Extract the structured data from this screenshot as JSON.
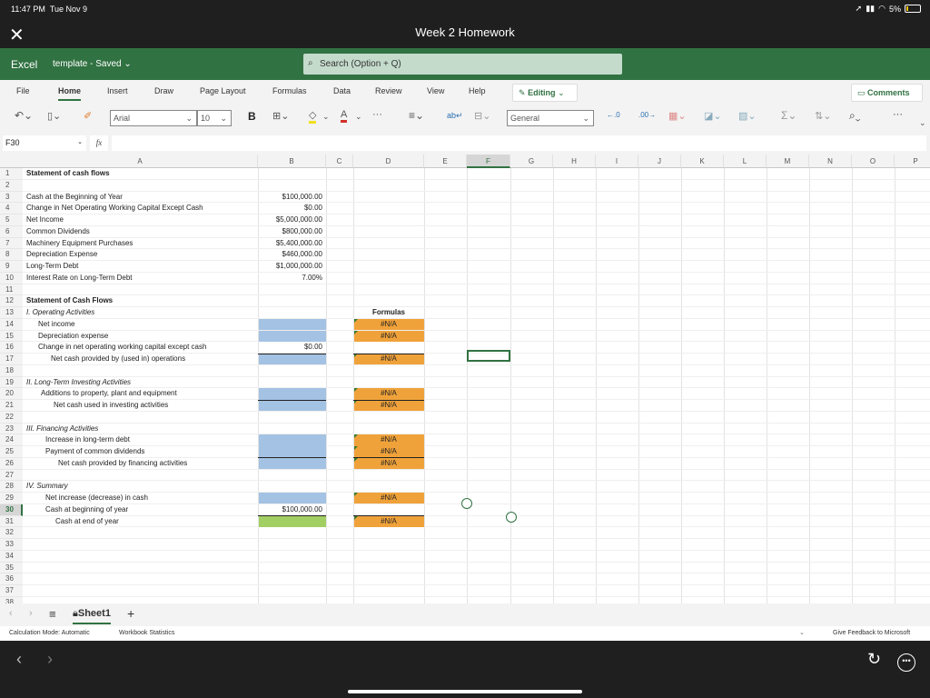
{
  "status_bar": {
    "time": "11:47 PM",
    "date": "Tue Nov 9",
    "battery": "5%"
  },
  "window": {
    "title": "Week 2 Homework",
    "close_icon": "close-icon"
  },
  "app_bar": {
    "app_name": "Excel",
    "doc_name": "template",
    "saved_status": "Saved",
    "search_placeholder": "Search (Option + Q)"
  },
  "ribbon": {
    "tabs": [
      {
        "label": "File"
      },
      {
        "label": "Home",
        "active": true
      },
      {
        "label": "Insert"
      },
      {
        "label": "Draw"
      },
      {
        "label": "Page Layout"
      },
      {
        "label": "Formulas"
      },
      {
        "label": "Data"
      },
      {
        "label": "Review"
      },
      {
        "label": "View"
      },
      {
        "label": "Help"
      }
    ],
    "editing_label": "Editing",
    "comments_label": "Comments",
    "font_name": "Arial",
    "font_size": "10",
    "bold_label": "B",
    "number_format": "General",
    "more_label": "···"
  },
  "formula_bar": {
    "name_box": "F30",
    "fx_label": "fx",
    "formula": ""
  },
  "columns": [
    "A",
    "B",
    "C",
    "D",
    "E",
    "F",
    "G",
    "H",
    "I",
    "J",
    "K",
    "L",
    "M",
    "N",
    "O",
    "P"
  ],
  "selected_column": "F",
  "selected_row": "30",
  "rows": [
    "1",
    "2",
    "3",
    "4",
    "5",
    "6",
    "7",
    "8",
    "9",
    "10",
    "11",
    "12",
    "13",
    "14",
    "15",
    "16",
    "17",
    "18",
    "19",
    "20",
    "21",
    "22",
    "23",
    "24",
    "25",
    "26",
    "27",
    "28",
    "29",
    "30",
    "31",
    "32",
    "33",
    "34",
    "35",
    "36",
    "37",
    "38"
  ],
  "cells": {
    "A1": "Statement of cash flows",
    "A3": "Cash at the Beginning of Year",
    "A4": "Change in Net Operating Working Capital Except Cash",
    "A5": "Net Income",
    "A6": "Common Dividends",
    "A7": "Machinery Equipment Purchases",
    "A8": "Depreciation Expense",
    "A9": "Long-Term Debt",
    "A10": "Interest Rate on Long-Term Debt",
    "B3": "$100,000.00",
    "B4": "$0.00",
    "B5": "$5,000,000.00",
    "B6": "$800,000.00",
    "B7": "$5,400,000.00",
    "B8": "$460,000.00",
    "B9": "$1,000,000.00",
    "B10": "7.00%",
    "A12": "Statement of Cash Flows",
    "A13": "I.  Operating Activities",
    "D13": "Formulas",
    "A14": "Net income",
    "A15": "Depreciation expense",
    "A16": "Change in net operating working capital except cash",
    "B16": "$0.00",
    "A17": "Net cash provided by (used in) operations",
    "A19": "II.  Long-Term Investing Activities",
    "A20": "Additions to property, plant and equipment",
    "A21": "Net cash used in investing activities",
    "A23": "III.  Financing Activities",
    "A24": "Increase in long-term debt",
    "A25": "Payment of common dividends",
    "A26": "Net cash provided by financing activities",
    "A28": "IV.  Summary",
    "A29": "Net increase (decrease) in cash",
    "A30": "Cash at beginning of year",
    "B30": "$100,000.00",
    "A31": "Cash at end of year",
    "D14": "#N/A",
    "D15": "#N/A",
    "D17": "#N/A",
    "D20": "#N/A",
    "D21": "#N/A",
    "D24": "#N/A",
    "D25": "#N/A",
    "D26": "#N/A",
    "D29": "#N/A",
    "D31": "#N/A"
  },
  "fill_colors": {
    "input_blue": "#a4c2e3",
    "formula_orange": "#f0a23a",
    "result_green": "#a2cf64",
    "accent_green": "#317242"
  },
  "sheet_tabs": {
    "sheets": [
      {
        "label": "Sheet1",
        "active": true,
        "locked": true
      }
    ],
    "add_label": "+"
  },
  "footer": {
    "calc_mode": "Calculation Mode: Automatic",
    "workbook_stats": "Workbook Statistics",
    "feedback": "Give Feedback to Microsoft"
  }
}
